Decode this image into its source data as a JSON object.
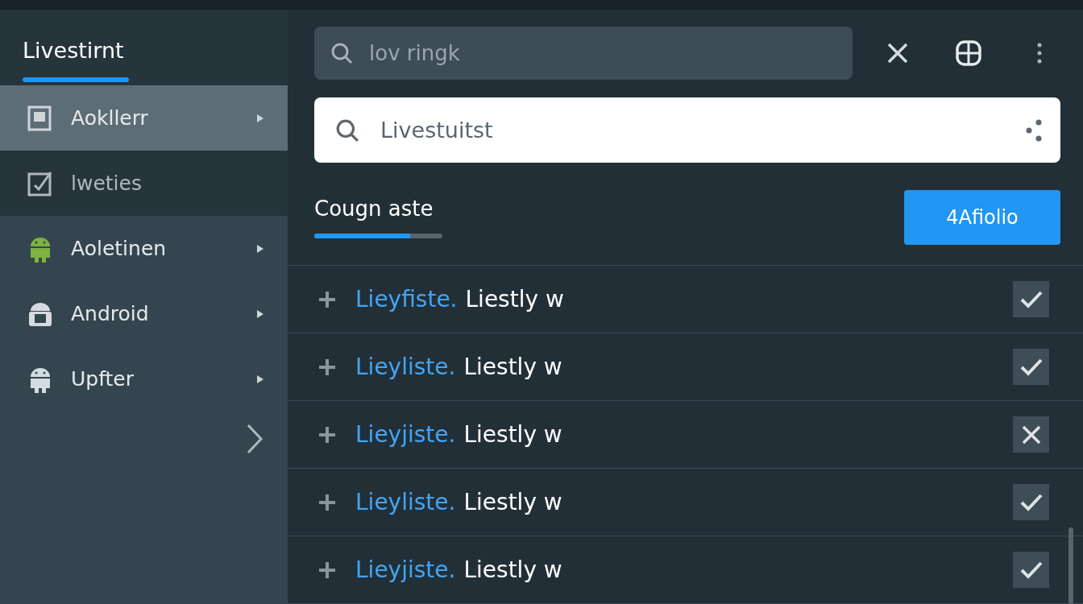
{
  "sidebar": {
    "title": "Livestirnt",
    "items": [
      {
        "label": "Aokllerr",
        "kind": "document",
        "selected": true,
        "focused": false,
        "has_submenu": true
      },
      {
        "label": "lweties",
        "kind": "checkbox",
        "selected": false,
        "focused": true,
        "has_submenu": false
      },
      {
        "label": "Aoletinen",
        "kind": "android",
        "color": "#7cb342",
        "selected": false,
        "focused": false,
        "has_submenu": true
      },
      {
        "label": "Android",
        "kind": "robot",
        "color": "#d5dbe0",
        "selected": false,
        "focused": false,
        "has_submenu": true
      },
      {
        "label": "Upfter",
        "kind": "android",
        "color": "#d5dbe0",
        "selected": false,
        "focused": false,
        "has_submenu": true
      }
    ]
  },
  "toolbar": {
    "search": {
      "value": "lov ringk"
    }
  },
  "search": {
    "value": "Livestuitst"
  },
  "tab": {
    "label": "Cougn aste",
    "level": 0.75
  },
  "action_button": "4Afiolio",
  "rows": [
    {
      "link": "Lieyfiste.",
      "text": "Liestly w",
      "checked": true
    },
    {
      "link": "Lieyliste.",
      "text": "Liestly w",
      "checked": true
    },
    {
      "link": "Lieyjiste.",
      "text": "Liestly w",
      "checked": false
    },
    {
      "link": "Lieyliste.",
      "text": "Liestly w",
      "checked": true
    },
    {
      "link": "Lieyjiste.",
      "text": "Liestly w",
      "checked": true
    }
  ]
}
